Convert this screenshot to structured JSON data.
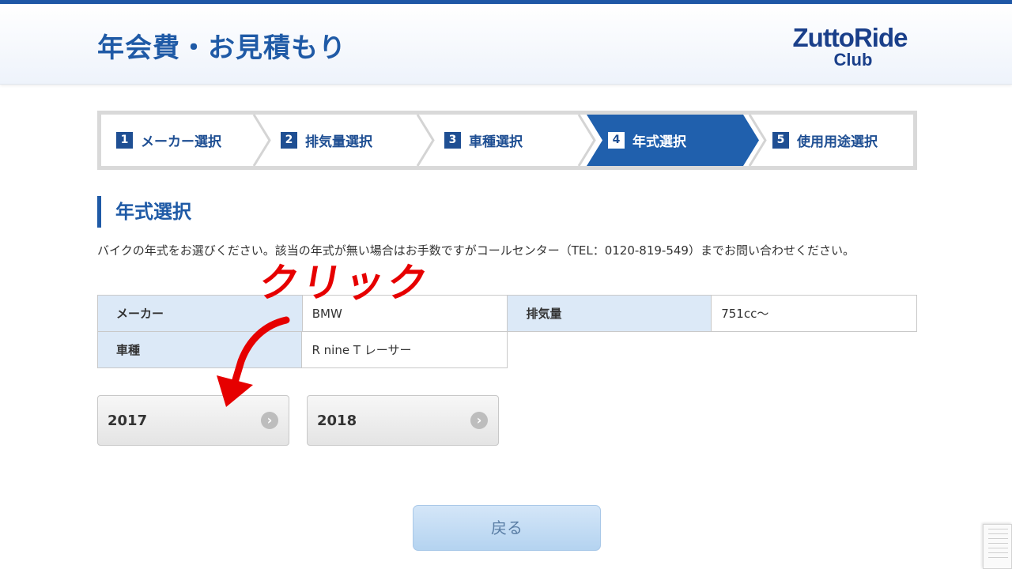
{
  "header": {
    "title": "年会費・お見積もり",
    "logo_line1": "ZuttoRide",
    "logo_line2": "Club"
  },
  "steps": [
    {
      "num": "1",
      "label": "メーカー選択",
      "active": false
    },
    {
      "num": "2",
      "label": "排気量選択",
      "active": false
    },
    {
      "num": "3",
      "label": "車種選択",
      "active": false
    },
    {
      "num": "4",
      "label": "年式選択",
      "active": true
    },
    {
      "num": "5",
      "label": "使用用途選択",
      "active": false
    }
  ],
  "section": {
    "title": "年式選択",
    "description": "バイクの年式をお選びください。該当の年式が無い場合はお手数ですがコールセンター（TEL：0120-819-549）までお問い合わせください。"
  },
  "info": {
    "maker_label": "メーカー",
    "maker_value": "BMW",
    "displacement_label": "排気量",
    "displacement_value": "751cc〜",
    "model_label": "車種",
    "model_value": "R nine T レーサー"
  },
  "years": [
    "2017",
    "2018"
  ],
  "back_label": "戻る",
  "annotation": {
    "text": "クリック",
    "color": "#e60000"
  },
  "colors": {
    "brand": "#1f5aa6",
    "step_active": "#2060ad",
    "table_header": "#dce9f7"
  }
}
